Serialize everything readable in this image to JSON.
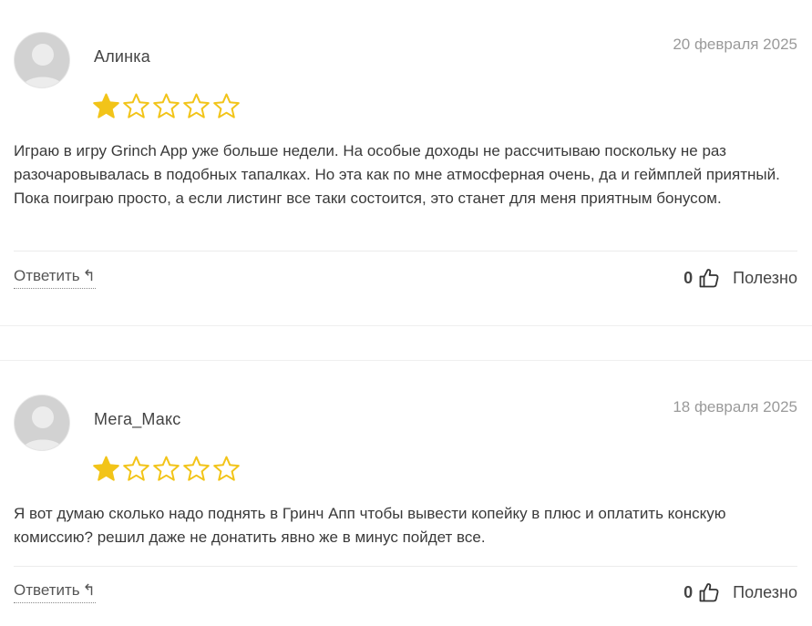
{
  "colors": {
    "star_filled": "#f2c419",
    "star_outline": "#f2c419",
    "avatar_bg": "#d2d2d2",
    "avatar_figure": "#ececec"
  },
  "icons": {
    "avatar": "avatar-placeholder-icon",
    "star": "star-icon",
    "reply": "reply-arrow-icon",
    "like": "thumbs-up-icon"
  },
  "reviews": [
    {
      "author": "Алинка",
      "date": "20 февраля 2025",
      "rating": 1,
      "rating_max": 5,
      "text": "Играю в игру Grinch App уже больше недели. На особые доходы не рассчитываю поскольку не раз разочаровывалась в подобных тапалках. Но эта как по мне атмосферная очень, да и геймплей приятный. Пока поиграю просто, а если листинг все таки состоится, это станет для меня приятным бонусом.",
      "reply_label": "Ответить",
      "reply_icon_glyph": "↰",
      "likes": "0",
      "helpful_label": "Полезно"
    },
    {
      "author": "Мега_Макс",
      "date": "18 февраля 2025",
      "rating": 1,
      "rating_max": 5,
      "text": "Я вот думаю сколько надо поднять в Гринч Апп чтобы вывести копейку в плюс и оплатить конскую комиссию? решил даже не донатить явно же в минус пойдет все.",
      "reply_label": "Ответить",
      "reply_icon_glyph": "↰",
      "likes": "0",
      "helpful_label": "Полезно"
    }
  ]
}
